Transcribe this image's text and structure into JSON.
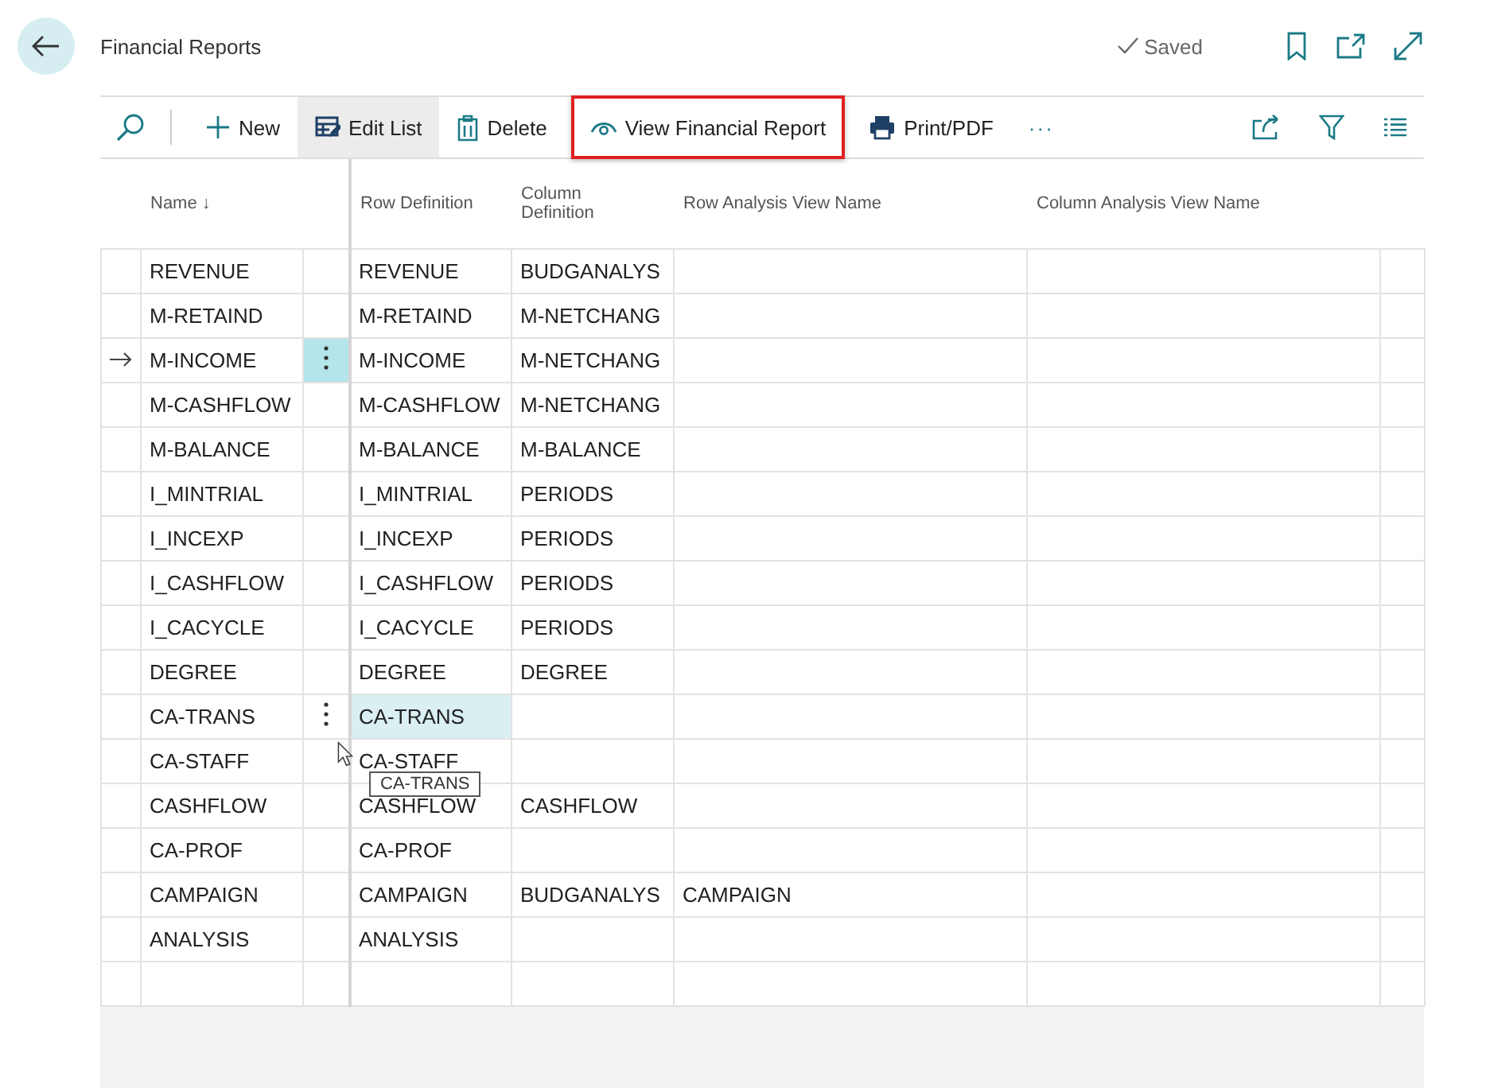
{
  "page": {
    "title": "Financial Reports",
    "status": "Saved"
  },
  "toolbar": {
    "actions": [
      {
        "kind": "new",
        "label": "New",
        "active": false,
        "highlighted": false
      },
      {
        "kind": "edit",
        "label": "Edit List",
        "active": true,
        "highlighted": false
      },
      {
        "kind": "delete",
        "label": "Delete",
        "active": false,
        "highlighted": false
      },
      {
        "kind": "view",
        "label": "View Financial Report",
        "active": false,
        "highlighted": true
      },
      {
        "kind": "print",
        "label": "Print/PDF",
        "active": false,
        "highlighted": false
      }
    ],
    "more": "···"
  },
  "table": {
    "columns": [
      {
        "label": "Name",
        "sort_glyph": "↓"
      },
      {
        "label": "Row Definition"
      },
      {
        "label": "Column Definition"
      },
      {
        "label": "Row Analysis View Name"
      },
      {
        "label": "Column Analysis View Name"
      }
    ],
    "rows": [
      {
        "name": "REVENUE",
        "row_definition": "REVENUE",
        "column_definition": "BUDGANALYS",
        "row_analysis_view": "",
        "selected": false,
        "hovered": false
      },
      {
        "name": "M-RETAIND",
        "row_definition": "M-RETAIND",
        "column_definition": "M-NETCHANG",
        "row_analysis_view": "",
        "selected": false,
        "hovered": false
      },
      {
        "name": "M-INCOME",
        "row_definition": "M-INCOME",
        "column_definition": "M-NETCHANG",
        "row_analysis_view": "",
        "selected": true,
        "hovered": false
      },
      {
        "name": "M-CASHFLOW",
        "row_definition": "M-CASHFLOW",
        "column_definition": "M-NETCHANG",
        "row_analysis_view": "",
        "selected": false,
        "hovered": false
      },
      {
        "name": "M-BALANCE",
        "row_definition": "M-BALANCE",
        "column_definition": "M-BALANCE",
        "row_analysis_view": "",
        "selected": false,
        "hovered": false
      },
      {
        "name": "I_MINTRIAL",
        "row_definition": "I_MINTRIAL",
        "column_definition": "PERIODS",
        "row_analysis_view": "",
        "selected": false,
        "hovered": false
      },
      {
        "name": "I_INCEXP",
        "row_definition": "I_INCEXP",
        "column_definition": "PERIODS",
        "row_analysis_view": "",
        "selected": false,
        "hovered": false
      },
      {
        "name": "I_CASHFLOW",
        "row_definition": "I_CASHFLOW",
        "column_definition": "PERIODS",
        "row_analysis_view": "",
        "selected": false,
        "hovered": false
      },
      {
        "name": "I_CACYCLE",
        "row_definition": "I_CACYCLE",
        "column_definition": "PERIODS",
        "row_analysis_view": "",
        "selected": false,
        "hovered": false
      },
      {
        "name": "DEGREE",
        "row_definition": "DEGREE",
        "column_definition": "DEGREE",
        "row_analysis_view": "",
        "selected": false,
        "hovered": false
      },
      {
        "name": "CA-TRANS",
        "row_definition": "CA-TRANS",
        "column_definition": "",
        "row_analysis_view": "",
        "selected": false,
        "hovered": true
      },
      {
        "name": "CA-STAFF",
        "row_definition": "CA-STAFF",
        "column_definition": "",
        "row_analysis_view": "",
        "selected": false,
        "hovered": false
      },
      {
        "name": "CASHFLOW",
        "row_definition": "CASHFLOW",
        "column_definition": "CASHFLOW",
        "row_analysis_view": "",
        "selected": false,
        "hovered": false
      },
      {
        "name": "CA-PROF",
        "row_definition": "CA-PROF",
        "column_definition": "",
        "row_analysis_view": "",
        "selected": false,
        "hovered": false
      },
      {
        "name": "CAMPAIGN",
        "row_definition": "CAMPAIGN",
        "column_definition": "BUDGANALYS",
        "row_analysis_view": "CAMPAIGN",
        "selected": false,
        "hovered": false
      },
      {
        "name": "ANALYSIS",
        "row_definition": "ANALYSIS",
        "column_definition": "",
        "row_analysis_view": "",
        "selected": false,
        "hovered": false
      }
    ]
  },
  "tooltip": {
    "text": "CA-TRANS"
  }
}
